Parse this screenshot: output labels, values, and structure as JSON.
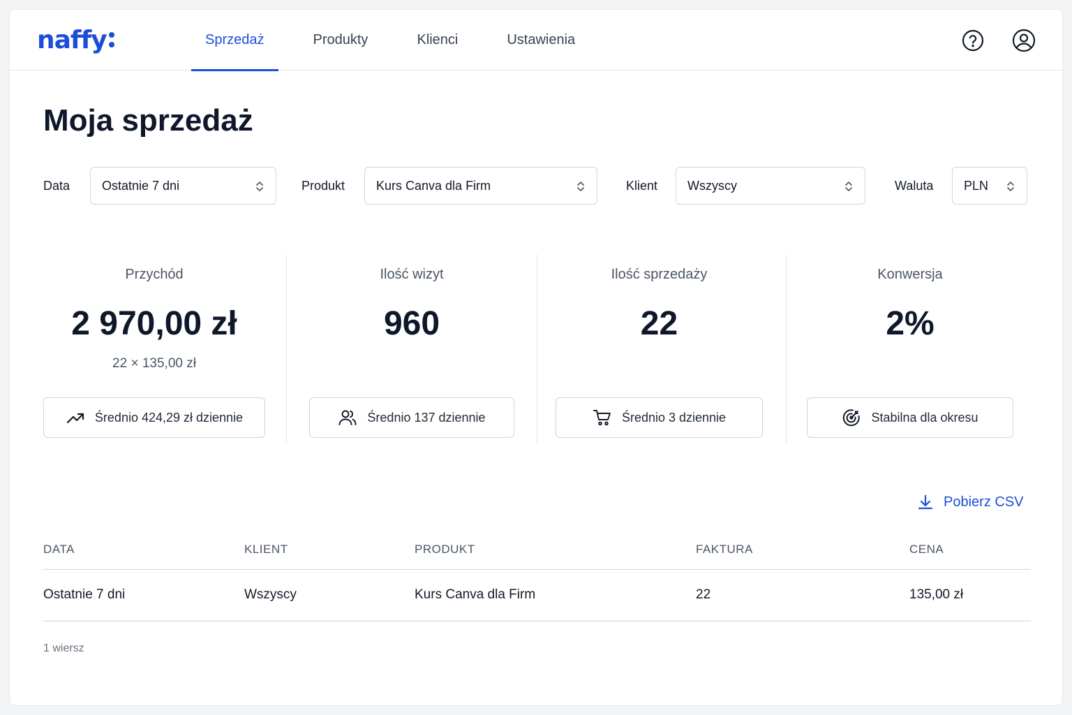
{
  "app": {
    "logo_text": "naffy",
    "brand_color": "#1d4ed8"
  },
  "nav": {
    "tabs": [
      {
        "label": "Sprzedaż",
        "active": true
      },
      {
        "label": "Produkty",
        "active": false
      },
      {
        "label": "Klienci",
        "active": false
      },
      {
        "label": "Ustawienia",
        "active": false
      }
    ],
    "icons": [
      "help-circle-icon",
      "user-circle-icon"
    ]
  },
  "page": {
    "title": "Moja sprzedaż"
  },
  "filters": {
    "date": {
      "label": "Data",
      "value": "Ostatnie 7 dni"
    },
    "product": {
      "label": "Produkt",
      "value": "Kurs Canva dla Firm"
    },
    "client": {
      "label": "Klient",
      "value": "Wszyscy"
    },
    "currency": {
      "label": "Waluta",
      "value": "PLN"
    }
  },
  "stats": [
    {
      "label": "Przychód",
      "value": "2 970,00 zł",
      "sub": "22 × 135,00 zł",
      "chip": "Średnio 424,29 zł dziennie",
      "icon": "trending-up-icon"
    },
    {
      "label": "Ilość wizyt",
      "value": "960",
      "sub": "",
      "chip": "Średnio 137 dziennie",
      "icon": "users-icon"
    },
    {
      "label": "Ilość sprzedaży",
      "value": "22",
      "sub": "",
      "chip": "Średnio 3 dziennie",
      "icon": "cart-icon"
    },
    {
      "label": "Konwersja",
      "value": "2%",
      "sub": "",
      "chip": "Stabilna dla okresu",
      "icon": "target-icon"
    }
  ],
  "actions": {
    "download_csv": "Pobierz CSV"
  },
  "table": {
    "columns": [
      "DATA",
      "KLIENT",
      "PRODUKT",
      "FAKTURA",
      "CENA"
    ],
    "rows": [
      [
        "Ostatnie 7 dni",
        "Wszyscy",
        "Kurs Canva dla Firm",
        "22",
        "135,00 zł"
      ]
    ],
    "row_count": "1 wiersz"
  }
}
